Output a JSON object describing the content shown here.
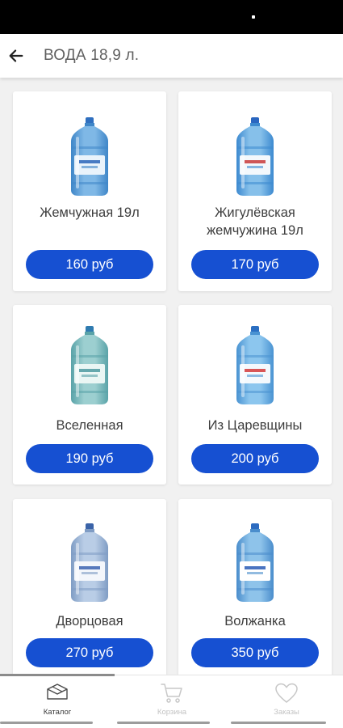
{
  "header": {
    "title": "ВОДА 18,9 л.",
    "back_icon": "arrow-left-icon"
  },
  "products": [
    {
      "name": "Жемчужная 19л",
      "price": "160 руб",
      "icon": "water-bottle-icon"
    },
    {
      "name": "Жигулёвская жемчужина 19л",
      "price": "170 руб",
      "icon": "water-bottle-icon"
    },
    {
      "name": "Вселенная",
      "price": "190 руб",
      "icon": "water-bottle-icon"
    },
    {
      "name": "Из Царевщины",
      "price": "200 руб",
      "icon": "water-bottle-icon"
    },
    {
      "name": "Дворцовая",
      "price": "270 руб",
      "icon": "water-bottle-icon"
    },
    {
      "name": "Волжанка",
      "price": "350 руб",
      "icon": "water-bottle-icon"
    }
  ],
  "tabs": [
    {
      "label": "Каталог",
      "icon": "catalog-box-icon",
      "active": true
    },
    {
      "label": "Корзина",
      "icon": "cart-icon",
      "active": false
    },
    {
      "label": "Заказы",
      "icon": "heart-icon",
      "active": false
    }
  ],
  "colors": {
    "accent": "#1650d2",
    "background": "#f1f1f1",
    "card": "#ffffff",
    "text": "#3d3d3d"
  }
}
